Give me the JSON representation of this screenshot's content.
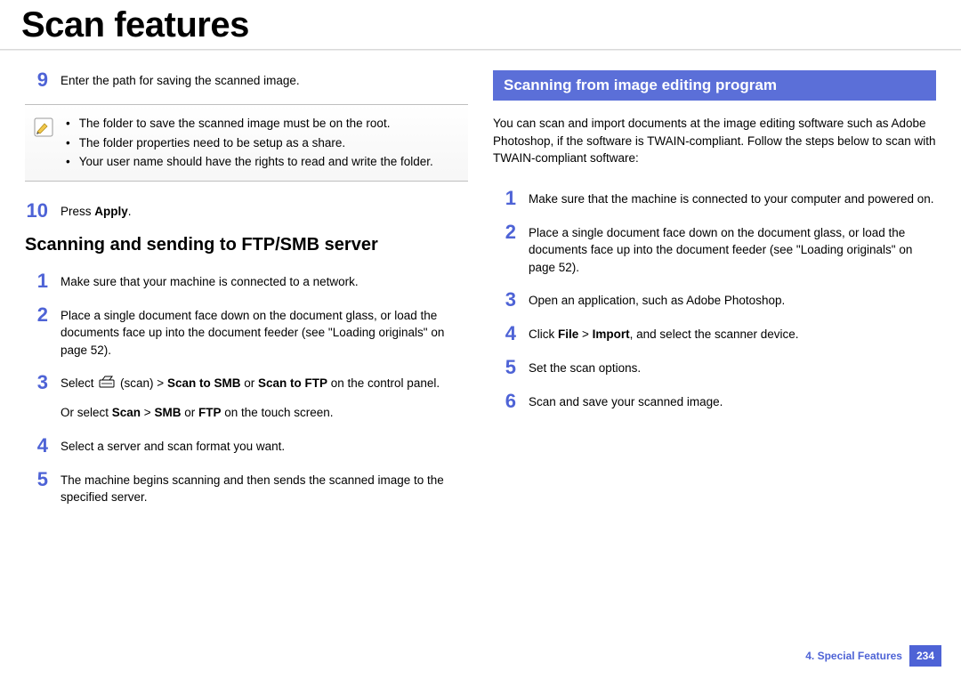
{
  "title": "Scan features",
  "left": {
    "steps_top": [
      {
        "num": "9",
        "text": "Enter the path for saving the scanned image."
      }
    ],
    "note": {
      "items": [
        "The folder to save the scanned image must be on the root.",
        "The folder properties need to be setup as a share.",
        "Your user name should have the rights to read and write the folder."
      ]
    },
    "step10": {
      "num": "10",
      "prefix": "Press ",
      "bold": "Apply",
      "suffix": "."
    },
    "heading": "Scanning and sending to FTP/SMB server",
    "steps": [
      {
        "num": "1",
        "text": "Make sure that your machine is connected to a network."
      },
      {
        "num": "2",
        "text": "Place a single document face down on the document glass, or load the documents face up into the document feeder (see \"Loading originals\" on page 52)."
      },
      {
        "num": "3",
        "line1_a": "Select ",
        "line1_b": "(scan) > ",
        "line1_bold1": "Scan to SMB",
        "line1_mid": " or ",
        "line1_bold2": "Scan to FTP",
        "line1_end": " on the control panel.",
        "line2_a": "Or select ",
        "line2_bold1": "Scan",
        "line2_mid1": " > ",
        "line2_bold2": "SMB",
        "line2_mid2": " or ",
        "line2_bold3": "FTP",
        "line2_end": " on the touch screen."
      },
      {
        "num": "4",
        "text": "Select a server and scan format you want."
      },
      {
        "num": "5",
        "text": "The machine begins scanning and then sends the scanned image to the specified server."
      }
    ]
  },
  "right": {
    "heading": "Scanning from image editing program",
    "intro": "You can scan and import documents at the image editing software such as Adobe Photoshop, if the software is TWAIN-compliant. Follow the steps below to scan with TWAIN-compliant software:",
    "steps": [
      {
        "num": "1",
        "text": "Make sure that the machine is connected to your computer and powered on."
      },
      {
        "num": "2",
        "text": "Place a single document face down on the document glass, or load the documents face up into the document feeder (see \"Loading originals\" on page 52)."
      },
      {
        "num": "3",
        "text": "Open an application, such as Adobe Photoshop."
      },
      {
        "num": "4",
        "prefix": "Click ",
        "bold1": "File",
        "mid": " > ",
        "bold2": "Import",
        "suffix": ", and select the scanner device."
      },
      {
        "num": "5",
        "text": "Set the scan options."
      },
      {
        "num": "6",
        "text": "Scan and save your scanned image."
      }
    ]
  },
  "footer": {
    "chapter": "4.  Special Features",
    "page": "234"
  }
}
